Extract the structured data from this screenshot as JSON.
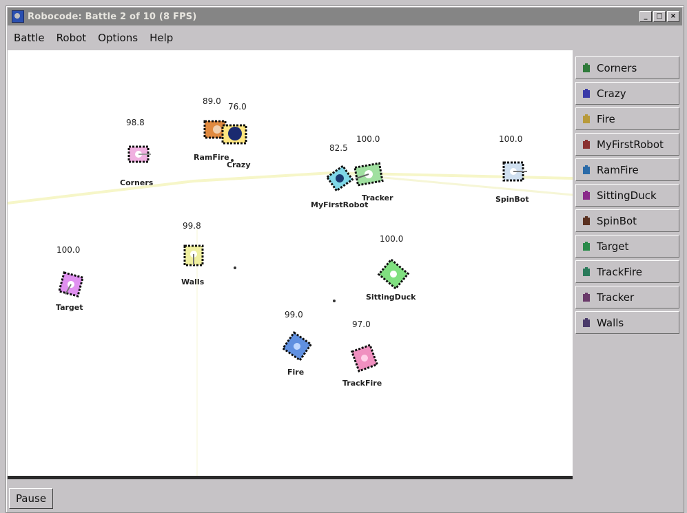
{
  "window": {
    "title": "Robocode: Battle 2 of 10 (8 FPS)"
  },
  "window_buttons": {
    "minimize": "_",
    "maximize": "□",
    "close": "×"
  },
  "menu": [
    "Battle",
    "Robot",
    "Options",
    "Help"
  ],
  "robots_list": [
    {
      "name": "Corners",
      "color": "#2f7a3a"
    },
    {
      "name": "Crazy",
      "color": "#3a3aa8"
    },
    {
      "name": "Fire",
      "color": "#b89a3a"
    },
    {
      "name": "MyFirstRobot",
      "color": "#8a3030"
    },
    {
      "name": "RamFire",
      "color": "#2a6aa8"
    },
    {
      "name": "SittingDuck",
      "color": "#8a2a8a"
    },
    {
      "name": "SpinBot",
      "color": "#5a3020"
    },
    {
      "name": "Target",
      "color": "#2a8a4a"
    },
    {
      "name": "TrackFire",
      "color": "#2a7a5a"
    },
    {
      "name": "Tracker",
      "color": "#6a3a6a"
    },
    {
      "name": "Walls",
      "color": "#4a3a6a"
    }
  ],
  "arena": {
    "robots": [
      {
        "name": "Corners",
        "energy": "98.8",
        "color": "#f0b0e0"
      },
      {
        "name": "RamFire",
        "energy": "89.0",
        "color": "#e08a40"
      },
      {
        "name": "Crazy",
        "energy": "76.0",
        "color": "#1a2a70"
      },
      {
        "name": "Tracker",
        "energy": "100.0",
        "color": "#a0e0a0"
      },
      {
        "name": "MyFirstRobot",
        "energy": "82.5",
        "color": "#80d8e8"
      },
      {
        "name": "SpinBot",
        "energy": "100.0",
        "color": "#d0e0f0"
      },
      {
        "name": "Walls",
        "energy": "99.8",
        "color": "#f0f0a0"
      },
      {
        "name": "Target",
        "energy": "100.0",
        "color": "#e090f0"
      },
      {
        "name": "SittingDuck",
        "energy": "100.0",
        "color": "#80e080"
      },
      {
        "name": "Fire",
        "energy": "99.0",
        "color": "#6090e0"
      },
      {
        "name": "TrackFire",
        "energy": "97.0",
        "color": "#f090c0"
      }
    ]
  },
  "controls": {
    "pause_label": "Pause"
  }
}
